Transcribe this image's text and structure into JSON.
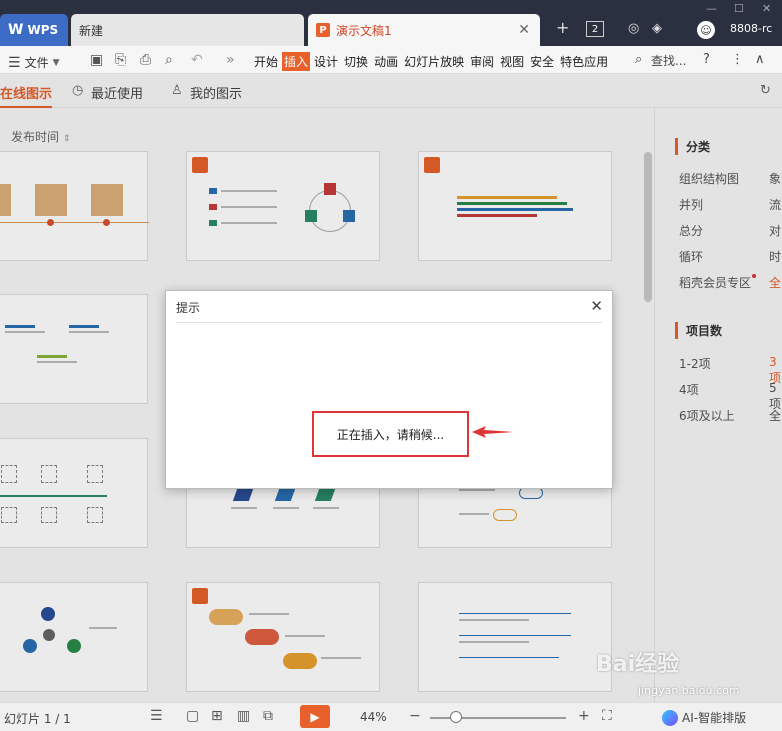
{
  "titlebar": {
    "wps_label": "WPS",
    "new_tab_label": "新建",
    "doc_tab_label": "演示文稿1",
    "tab_count": "2",
    "version": "8808-rc",
    "plus": "+"
  },
  "menubar": {
    "file_label": "文件",
    "tabs": [
      {
        "label": "开始"
      },
      {
        "label": "插入",
        "active": true
      },
      {
        "label": "设计"
      },
      {
        "label": "切换"
      },
      {
        "label": "动画"
      },
      {
        "label": "幻灯片放映"
      },
      {
        "label": "审阅"
      },
      {
        "label": "视图"
      },
      {
        "label": "安全"
      },
      {
        "label": "特色应用"
      }
    ],
    "search_label": "查找...",
    "help": "?",
    "more": "⋮",
    "collapse": "∧"
  },
  "subtabs": {
    "online": "在线图示",
    "recent": "最近使用",
    "mine": "我的图示"
  },
  "sort_label": "发布时间",
  "sidebar": {
    "category_title": "分类",
    "categories": [
      "组织结构图",
      "并列",
      "总分",
      "循环",
      "稻壳会员专区"
    ],
    "categories_right": [
      "象",
      "流",
      "对",
      "时",
      "全"
    ],
    "count_title": "项目数",
    "counts": [
      "1-2项",
      "4项",
      "6项及以上"
    ],
    "counts_right": [
      "3项",
      "5项",
      "全"
    ]
  },
  "dialog": {
    "title": "提示",
    "message": "正在插入，请稍候..."
  },
  "statusbar": {
    "slide_info": "幻灯片 1 / 1",
    "zoom": "44%",
    "ai_label": "AI-智能排版"
  },
  "watermark": {
    "main": "Bai经验",
    "sub": "jingyan.baidu.com"
  },
  "colors": {
    "accent": "#e8602b",
    "highlight_red": "#e03535",
    "titlebar": "#2b3040"
  }
}
